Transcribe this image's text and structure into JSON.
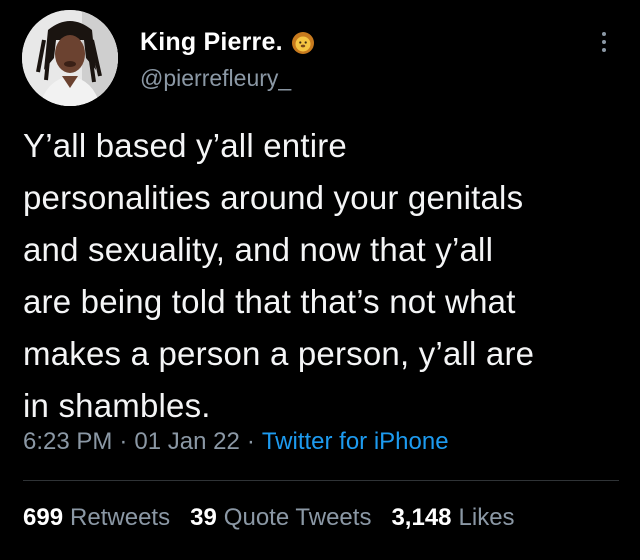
{
  "author": {
    "display_name": "King Pierre.",
    "handle": "@pierrefleury_",
    "badge_icon": "lion-emoji-icon"
  },
  "tweet": {
    "text": "Y’all based y’all entire\npersonalities around your genitals\nand sexuality, and now that y’all\nare being told that that’s not what\nmakes a person a person, y’all are\nin shambles."
  },
  "meta": {
    "time": "6:23 PM",
    "separator": "·",
    "date": "01 Jan 22",
    "source": "Twitter for iPhone"
  },
  "stats": [
    {
      "count": "699",
      "label": "Retweets"
    },
    {
      "count": "39",
      "label": "Quote Tweets"
    },
    {
      "count": "3,148",
      "label": "Likes"
    }
  ],
  "colors": {
    "background": "#000000",
    "link": "#1d9bf0",
    "muted": "#8b98a5"
  }
}
